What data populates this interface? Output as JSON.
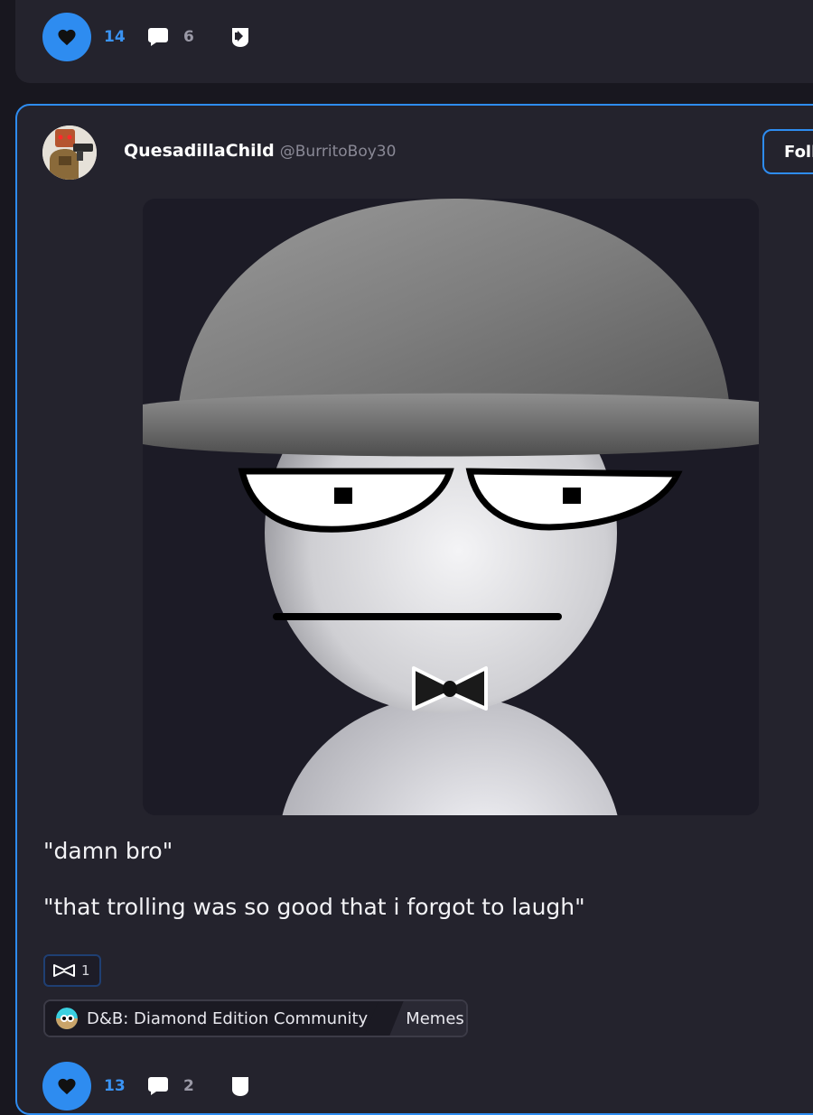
{
  "previous_post": {
    "like_count": "14",
    "comment_count": "6"
  },
  "post": {
    "author": {
      "display_name": "QuesadillaChild",
      "handle": "@BurritoBoy30"
    },
    "follow_label": "Foll",
    "text_lines": [
      "\"damn bro\"",
      "\"that trolling was so good that i forgot to laugh\""
    ],
    "reaction": {
      "icon": "bowtie-icon",
      "count": "1"
    },
    "community": {
      "name": "D&B: Diamond Edition Community",
      "category": "Memes",
      "category_icon": "star-icon"
    }
  },
  "next_post": {
    "like_count": "13",
    "comment_count": "2"
  },
  "colors": {
    "accent": "#2e8cf0",
    "background": "#18171f",
    "card": "#24232d"
  }
}
